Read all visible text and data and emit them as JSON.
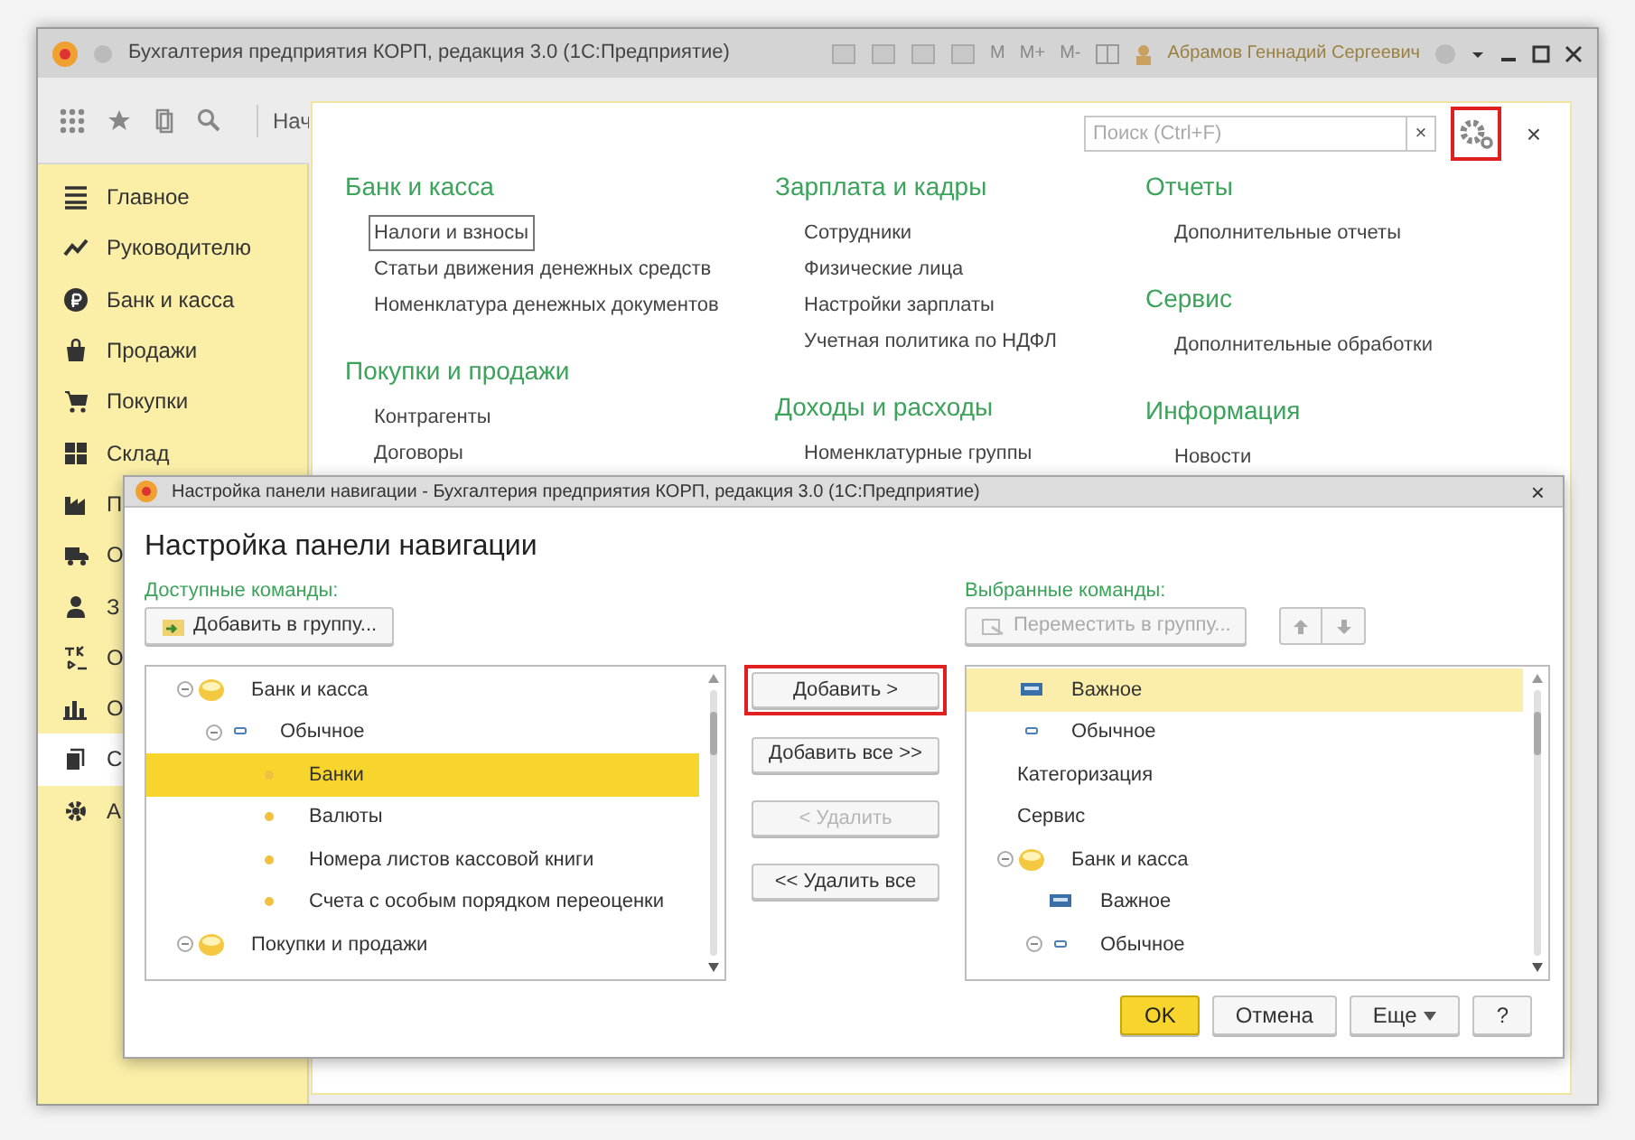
{
  "window": {
    "title": "Бухгалтерия предприятия КОРП, редакция 3.0  (1С:Предприятие)",
    "memory_buttons": [
      "M",
      "M+",
      "M-"
    ],
    "user": "Абрамов Геннадий Сергеевич"
  },
  "toolbar": {
    "tab_label": "Нач"
  },
  "sidebar": {
    "items": [
      {
        "label": "Главное",
        "selected": false
      },
      {
        "label": "Руководителю",
        "selected": false
      },
      {
        "label": "Банк и касса",
        "selected": false
      },
      {
        "label": "Продажи",
        "selected": false
      },
      {
        "label": "Покупки",
        "selected": false
      },
      {
        "label": "Склад",
        "selected": false
      },
      {
        "label": "П",
        "selected": false
      },
      {
        "label": "О",
        "selected": false
      },
      {
        "label": "З",
        "selected": false
      },
      {
        "label": "О",
        "selected": false
      },
      {
        "label": "О",
        "selected": false
      },
      {
        "label": "С",
        "selected": true
      },
      {
        "label": "А",
        "selected": false
      }
    ]
  },
  "nav_panel": {
    "search": {
      "placeholder": "Поиск (Ctrl+F)"
    },
    "clear_button": "×",
    "settings_button": {
      "highlighted": true
    },
    "close_button": "×",
    "columns": [
      {
        "sections": [
          {
            "title": "Банк и касса",
            "items": [
              {
                "label": "Налоги и взносы",
                "focused": true
              },
              {
                "label": "Статьи движения денежных средств",
                "focused": false
              },
              {
                "label": "Номенклатура денежных документов",
                "focused": false
              }
            ]
          },
          {
            "title": "Покупки и продажи",
            "items": [
              {
                "label": "Контрагенты",
                "focused": false
              },
              {
                "label": "Договоры",
                "focused": false
              }
            ]
          }
        ]
      },
      {
        "sections": [
          {
            "title": "Зарплата и кадры",
            "items": [
              {
                "label": "Сотрудники",
                "focused": false
              },
              {
                "label": "Физические лица",
                "focused": false
              },
              {
                "label": "Настройки зарплаты",
                "focused": false
              },
              {
                "label": "Учетная политика по НДФЛ",
                "focused": false
              }
            ]
          },
          {
            "title": "Доходы и расходы",
            "items": [
              {
                "label": "Номенклатурные группы",
                "focused": false
              }
            ]
          }
        ]
      },
      {
        "sections": [
          {
            "title": "Отчеты",
            "items": [
              {
                "label": "Дополнительные отчеты",
                "focused": false
              }
            ]
          },
          {
            "title": "Сервис",
            "items": [
              {
                "label": "Дополнительные обработки",
                "focused": false
              }
            ]
          },
          {
            "title": "Информация",
            "items": [
              {
                "label": "Новости",
                "focused": false
              }
            ]
          }
        ]
      }
    ]
  },
  "dialog": {
    "title": "Настройка панели навигации - Бухгалтерия предприятия КОРП, редакция 3.0  (1С:Предприятие)",
    "close_button": "×",
    "heading": "Настройка панели навигации",
    "available": {
      "label": "Доступные команды:",
      "button": {
        "label": "Добавить в группу...",
        "disabled": false
      },
      "tree": [
        {
          "kind": "group",
          "label": "Банк и касса",
          "expanded": true,
          "selected": false,
          "children": [
            {
              "kind": "normal",
              "label": "Обычное",
              "expanded": true,
              "selected": false,
              "children": [
                {
                  "kind": "command",
                  "label": "Банки",
                  "selected": true
                },
                {
                  "kind": "command",
                  "label": "Валюты",
                  "selected": false
                },
                {
                  "kind": "command",
                  "label": "Номера листов кассовой книги",
                  "selected": false
                },
                {
                  "kind": "command",
                  "label": "Счета с особым порядком переоценки",
                  "selected": false
                }
              ]
            }
          ]
        },
        {
          "kind": "group",
          "label": "Покупки и продажи",
          "expanded": true,
          "selected": false
        }
      ]
    },
    "middle_buttons": [
      {
        "label": "Добавить >",
        "disabled": false,
        "highlighted": true
      },
      {
        "label": "Добавить все >>",
        "disabled": false,
        "highlighted": false
      },
      {
        "label": "< Удалить",
        "disabled": true,
        "highlighted": false
      },
      {
        "label": "<< Удалить все",
        "disabled": false,
        "highlighted": false
      }
    ],
    "selected": {
      "label": "Выбранные команды:",
      "button": {
        "label": "Переместить в группу...",
        "disabled": true
      },
      "tree": [
        {
          "kind": "important",
          "label": "Важное",
          "selected": true
        },
        {
          "kind": "normal",
          "label": "Обычное",
          "selected": false
        },
        {
          "kind": "plain",
          "label": "Категоризация",
          "selected": false
        },
        {
          "kind": "plain",
          "label": "Сервис",
          "selected": false
        },
        {
          "kind": "group",
          "label": "Банк и касса",
          "expanded": true,
          "selected": false,
          "children": [
            {
              "kind": "important",
              "label": "Важное",
              "selected": false
            },
            {
              "kind": "normal",
              "label": "Обычное",
              "expanded": true,
              "selected": false
            }
          ]
        }
      ]
    },
    "footer_buttons": [
      {
        "label": "OK",
        "kind": "default"
      },
      {
        "label": "Отмена",
        "kind": "normal"
      },
      {
        "label": "Еще",
        "kind": "menu"
      },
      {
        "label": "?",
        "kind": "normal"
      }
    ]
  }
}
